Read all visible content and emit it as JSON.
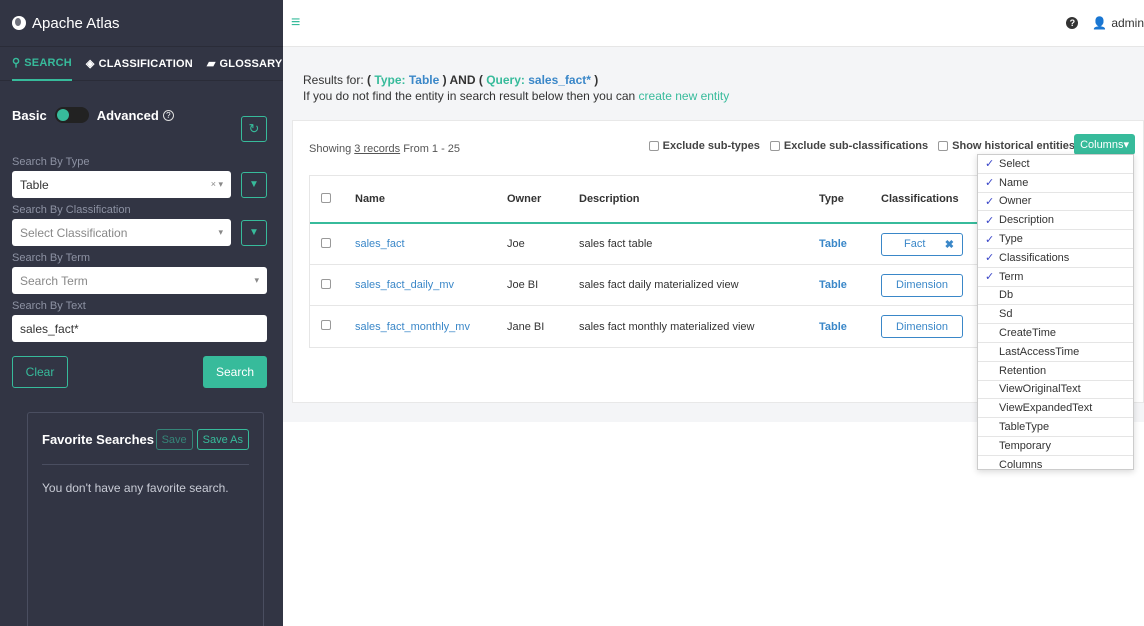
{
  "app": {
    "title": "Apache Atlas"
  },
  "sidebar": {
    "tabs": [
      {
        "label": "SEARCH",
        "icon": "search-icon"
      },
      {
        "label": "CLASSIFICATION",
        "icon": "tag-icon"
      },
      {
        "label": "GLOSSARY",
        "icon": "folder-icon"
      }
    ],
    "mode": {
      "basic": "Basic",
      "advanced": "Advanced"
    },
    "search_by_type": {
      "label": "Search By Type",
      "value": "Table"
    },
    "search_by_classification": {
      "label": "Search By Classification",
      "placeholder": "Select Classification"
    },
    "search_by_term": {
      "label": "Search By Term",
      "placeholder": "Search Term"
    },
    "search_by_text": {
      "label": "Search By Text",
      "value": "sales_fact*"
    },
    "clear_label": "Clear",
    "search_label": "Search",
    "favorites": {
      "title": "Favorite Searches",
      "save_label": "Save",
      "save_as_label": "Save As",
      "empty_text": "You don't have any favorite search."
    }
  },
  "header": {
    "user": "admin"
  },
  "results": {
    "prefix": "Results for:",
    "type_key": "Type:",
    "type_val": "Table",
    "and": "AND",
    "query_key": "Query:",
    "query_val": "sales_fact*",
    "hint": "If you do not find the entity in search result below then you can",
    "create_link": "create new entity",
    "showing_prefix": "Showing",
    "showing_count": "3 records",
    "showing_suffix": "From 1 - 25"
  },
  "options": {
    "exclude_subtypes": "Exclude sub-types",
    "exclude_subclass": "Exclude sub-classifications",
    "show_historical": "Show historical entities",
    "columns_label": "Columns"
  },
  "table": {
    "headers": {
      "name": "Name",
      "owner": "Owner",
      "description": "Description",
      "type": "Type",
      "classifications": "Classifications"
    },
    "rows": [
      {
        "name": "sales_fact",
        "owner": "Joe",
        "description": "sales fact table",
        "type": "Table",
        "classification": "Fact"
      },
      {
        "name": "sales_fact_daily_mv",
        "owner": "Joe BI",
        "description": "sales fact daily materialized view",
        "type": "Table",
        "classification": "Dimension"
      },
      {
        "name": "sales_fact_monthly_mv",
        "owner": "Jane BI",
        "description": "sales fact monthly materialized view",
        "type": "Table",
        "classification": "Dimension"
      }
    ]
  },
  "columns_menu": [
    {
      "label": "Select",
      "checked": true
    },
    {
      "label": "Name",
      "checked": true
    },
    {
      "label": "Owner",
      "checked": true
    },
    {
      "label": "Description",
      "checked": true
    },
    {
      "label": "Type",
      "checked": true
    },
    {
      "label": "Classifications",
      "checked": true
    },
    {
      "label": "Term",
      "checked": true
    },
    {
      "label": "Db",
      "checked": false
    },
    {
      "label": "Sd",
      "checked": false
    },
    {
      "label": "CreateTime",
      "checked": false
    },
    {
      "label": "LastAccessTime",
      "checked": false
    },
    {
      "label": "Retention",
      "checked": false
    },
    {
      "label": "ViewOriginalText",
      "checked": false
    },
    {
      "label": "ViewExpandedText",
      "checked": false
    },
    {
      "label": "TableType",
      "checked": false
    },
    {
      "label": "Temporary",
      "checked": false
    },
    {
      "label": "Columns",
      "checked": false
    }
  ],
  "colors": {
    "accent": "#37bb9b",
    "link": "#3a87c8",
    "sidebar": "#323544"
  }
}
